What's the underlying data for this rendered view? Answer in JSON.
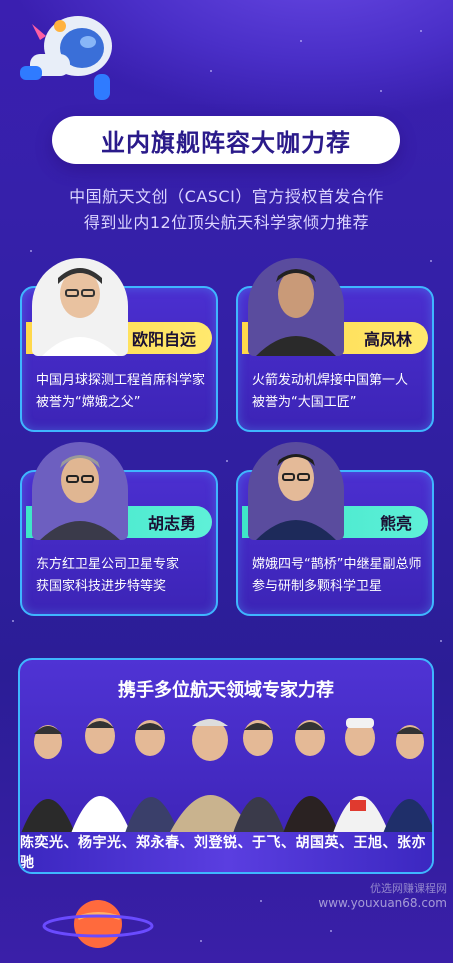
{
  "headline": "业内旗舰阵容大咖力荐",
  "intro": {
    "line1": "中国航天文创（CASCI）官方授权首发合作",
    "line2": "得到业内12位顶尖航天科学家倾力推荐"
  },
  "cards": [
    {
      "name": "欧阳自远",
      "desc1": "中国月球探测工程首席科学家",
      "desc2": "被誉为“嫦娥之父”",
      "tag_color": "#ffd84a"
    },
    {
      "name": "高凤林",
      "desc1": "火箭发动机焊接中国第一人",
      "desc2": "被誉为“大国工匠”",
      "tag_color": "#ffd84a"
    },
    {
      "name": "胡志勇",
      "desc1": "东方红卫星公司卫星专家",
      "desc2": "获国家科技进步特等奖",
      "tag_color": "#3ee6c8"
    },
    {
      "name": "熊亮",
      "desc1": "嫦娥四号“鹊桥”中继星副总师",
      "desc2": "参与研制多颗科学卫星",
      "tag_color": "#3ee6c8"
    }
  ],
  "experts": {
    "title": "携手多位航天领域专家力荐",
    "names": "陈奕光、杨宇光、郑永春、刘登锐、于飞、胡国英、王旭、张亦驰"
  },
  "watermark": {
    "line1": "优选网赚课程网",
    "line2": "www.youxuan68.com"
  },
  "colors": {
    "background": "#3320a6",
    "card_border": "#3fb6ff",
    "headline_text": "#2a1a8a"
  }
}
